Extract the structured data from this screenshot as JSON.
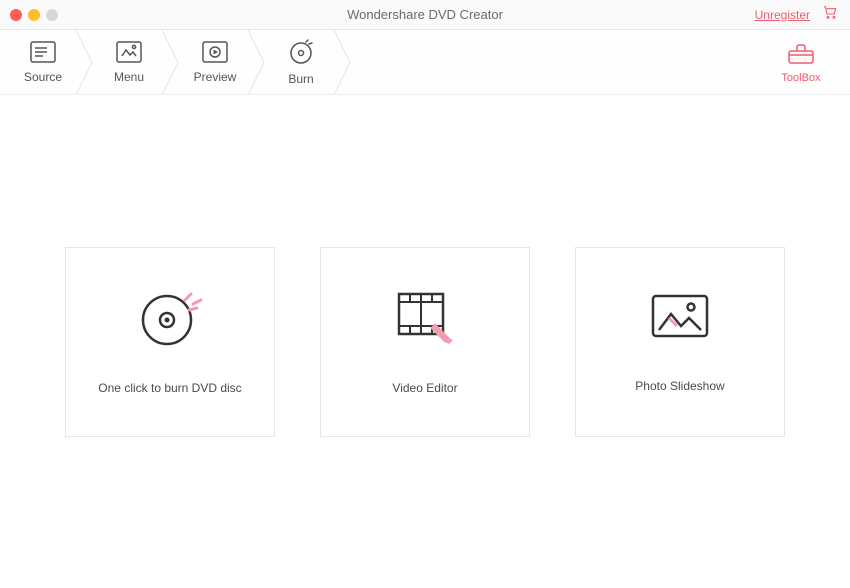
{
  "window": {
    "title": "Wondershare DVD Creator",
    "unregister": "Unregister"
  },
  "steps": {
    "source": "Source",
    "menu": "Menu",
    "preview": "Preview",
    "burn": "Burn"
  },
  "toolbox": {
    "label": "ToolBox"
  },
  "cards": {
    "burn_disc": "One click to burn DVD disc",
    "video_editor": "Video Editor",
    "photo_slideshow": "Photo Slideshow"
  },
  "colors": {
    "accent": "#f15b6c"
  }
}
